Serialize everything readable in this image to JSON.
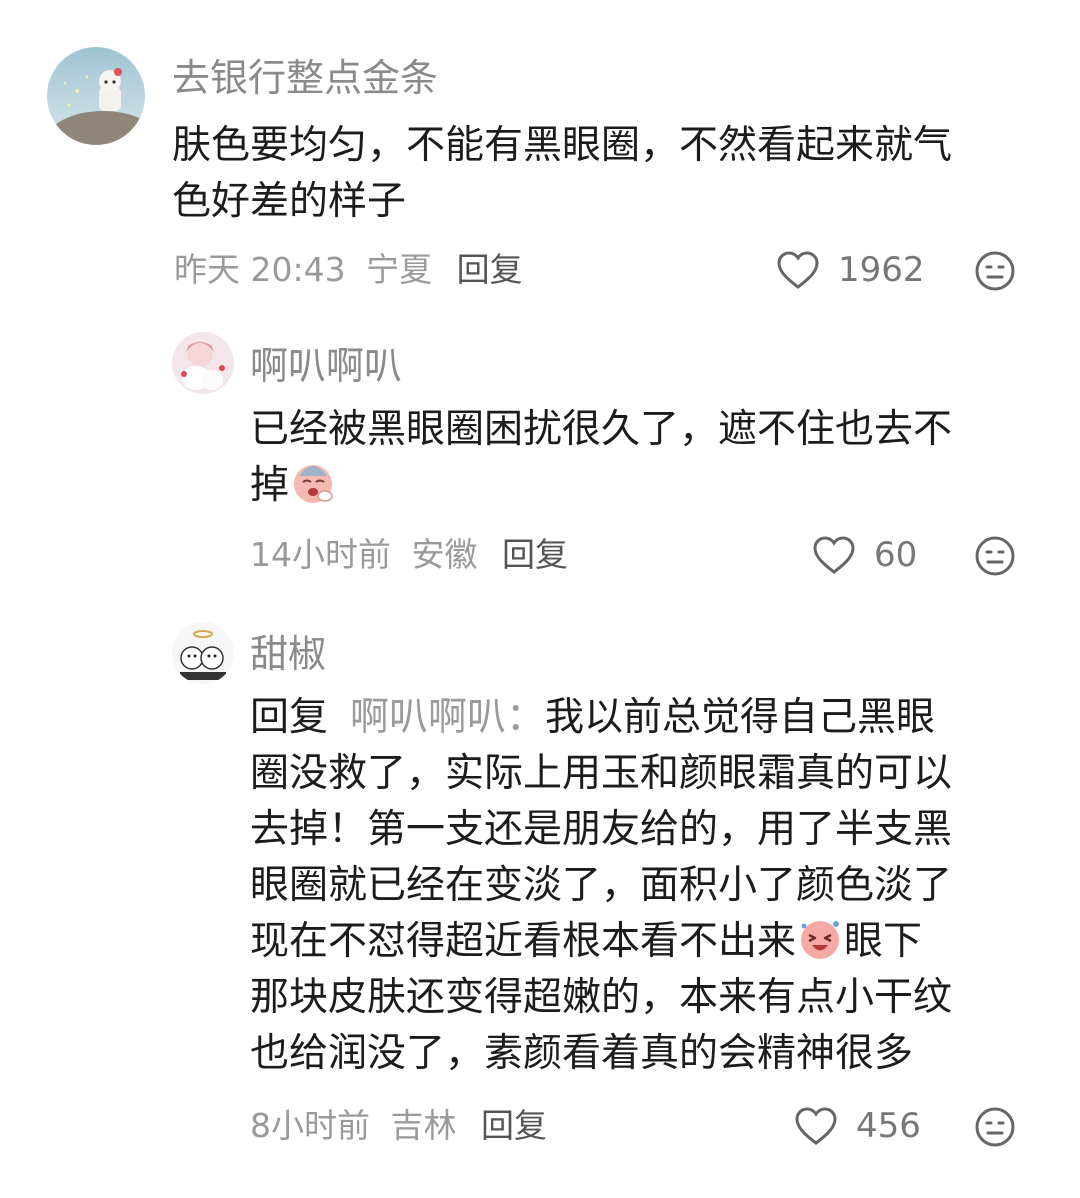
{
  "comments": [
    {
      "username": "去银行整点金条",
      "lines": [
        "肤色要均匀，不能有黑眼圈，不然看起来就气",
        "色好差的样子"
      ],
      "time": "昨天 20:43",
      "location": "宁夏",
      "reply_label": "回复",
      "likes": "1962"
    },
    {
      "username": "啊叭啊叭",
      "lines": [
        "已经被黑眼圈困扰很久了，遮不住也去不",
        "掉"
      ],
      "time": "14小时前",
      "location": "安徽",
      "reply_label": "回复",
      "likes": "60"
    },
    {
      "username": "甜椒",
      "reply_prefix": "回复",
      "reply_target": "啊叭啊叭：",
      "lines": [
        "我以前总觉得自己黑眼",
        "圈没救了，实际上用玉和颜眼霜真的可以",
        "去掉！第一支还是朋友给的，用了半支黑",
        "眼圈就已经在变淡了，面积小了颜色淡了",
        "现在不怼得超近看根本看不出来",
        "眼下",
        "那块皮肤还变得超嫩的，本来有点小干纹",
        "也给润没了，素颜看着真的会精神很多"
      ],
      "time": "8小时前",
      "location": "吉林",
      "reply_label": "回复",
      "likes": "456"
    }
  ],
  "icons": {
    "like": "heart-outline-icon",
    "dislike": "neutral-face-icon",
    "emoji_1": "crying-face-emoji",
    "emoji_2": "laughing-face-emoji"
  }
}
